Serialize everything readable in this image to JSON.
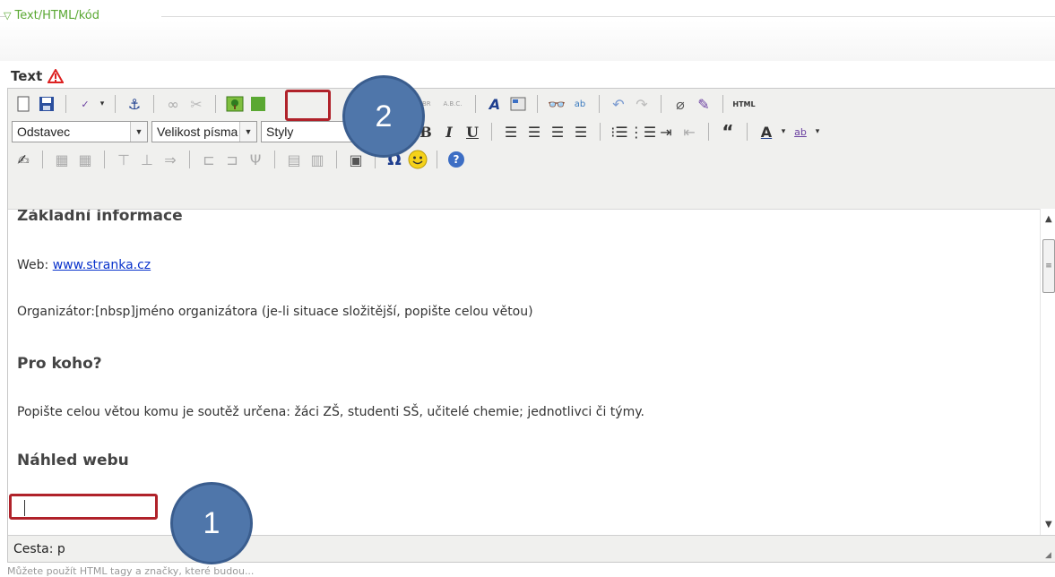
{
  "fieldset": {
    "legend": "Text/HTML/kód",
    "toggle_icon": "triangle-down-icon"
  },
  "field": {
    "label": "Text",
    "warning_icon": "warning-icon"
  },
  "toolbar": {
    "row1_html_label": "HTML",
    "format_select": "Odstavec",
    "size_select": "Velikost písma",
    "styles_select": "Styly",
    "bold": "B",
    "italic": "I",
    "underline": "U",
    "quote": "“",
    "font_color": "A",
    "highlight": "ab",
    "omega": "Ω"
  },
  "content": {
    "heading1": "Základní informace",
    "web_label": "Web: ",
    "web_link": "www.stranka.cz",
    "organizer": "Organizátor:[nbsp]jméno organizátora (je-li situace složitější, popište celou větou)",
    "heading2": "Pro koho?",
    "audience": "Popište celou větou komu je soutěž určena: žáci ZŠ, studenti SŠ, učitelé chemie; jednotlivci či týmy.",
    "heading3": "Náhled webu"
  },
  "status": {
    "path": "Cesta: p"
  },
  "bottom_note": "Můžete použít HTML tagy a značky, které budou...",
  "annotations": {
    "callout1": "1",
    "callout2": "2",
    "highlight_color": "#b0222a",
    "callout_color": "#4f76aa"
  }
}
